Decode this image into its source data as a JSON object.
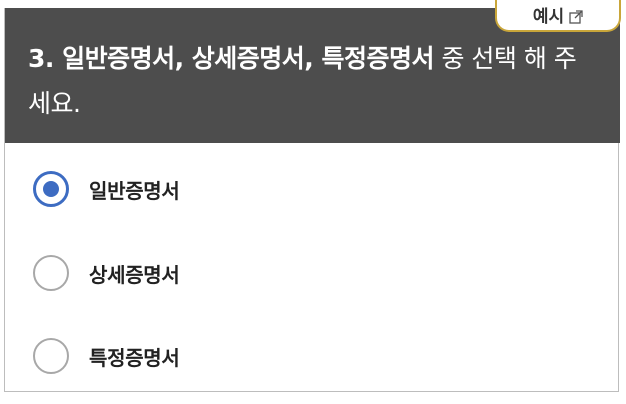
{
  "question": {
    "title_bold": "3. 일반증명서, 상세증명서, 특정증명서",
    "title_rest": " 중 선택 해 주세요."
  },
  "example_button": {
    "label": "예시",
    "icon": "external-link-icon"
  },
  "options": [
    {
      "label": "일반증명서",
      "checked": true
    },
    {
      "label": "상세증명서",
      "checked": false
    },
    {
      "label": "특정증명서",
      "checked": false
    }
  ],
  "colors": {
    "header_bg": "#4d4d4d",
    "accent": "#3d6cc2",
    "example_border": "#c9a63a"
  }
}
